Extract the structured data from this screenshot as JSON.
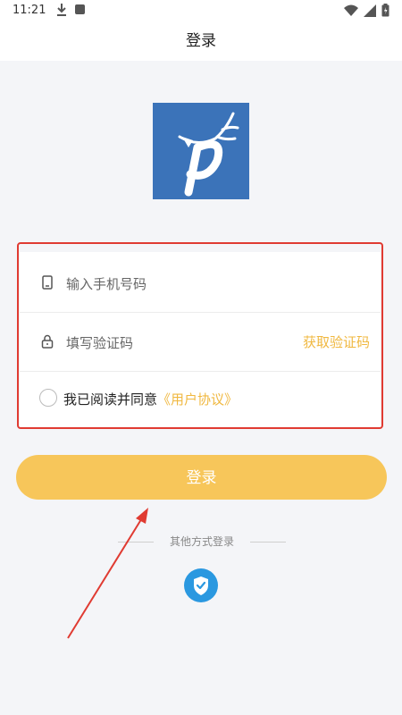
{
  "status_bar": {
    "time": "11:21"
  },
  "header": {
    "title": "登录"
  },
  "logo": {
    "bg_color": "#3b73b9"
  },
  "form": {
    "phone_placeholder": "输入手机号码",
    "code_placeholder": "填写验证码",
    "get_code_label": "获取验证码",
    "agree_text": "我已阅读并同意",
    "agreement_link": "《用户协议》"
  },
  "login_button": {
    "label": "登录"
  },
  "other_login": {
    "label": "其他方式登录"
  },
  "colors": {
    "accent": "#f0b840",
    "button": "#f7c65a",
    "highlight_frame": "#e03b32",
    "shield": "#2a98e0"
  }
}
